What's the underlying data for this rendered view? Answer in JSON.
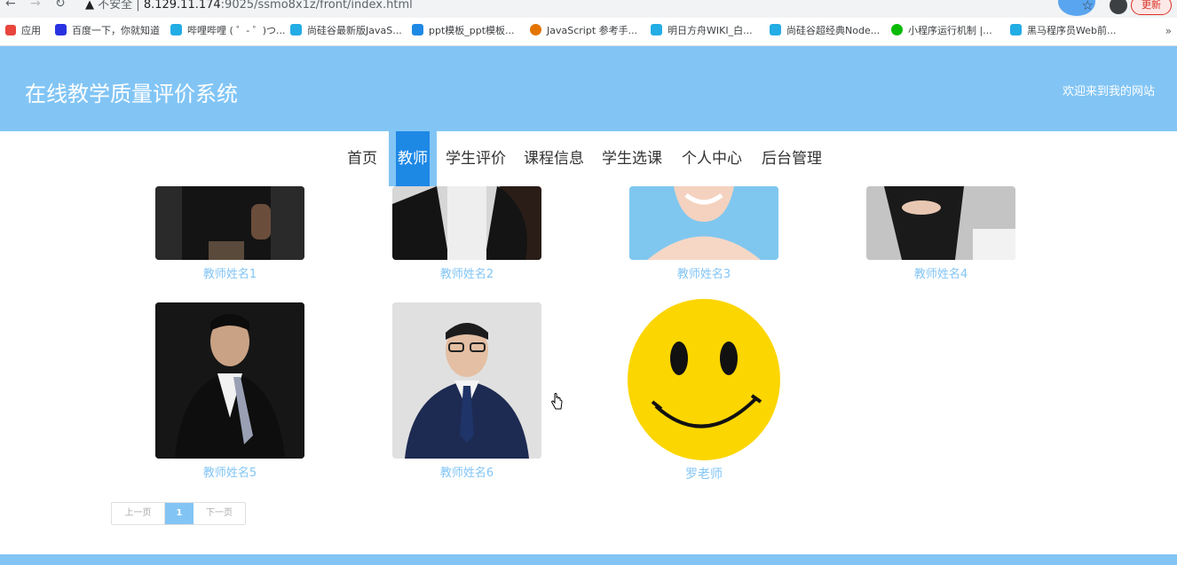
{
  "browser": {
    "back_icon": "arrow-left-icon",
    "warning_label": "不安全",
    "url_host": "8.129.11.174",
    "url_path": ":9025/ssmo8x1z/front/index.html",
    "update_label": "更新",
    "bookmarks": [
      {
        "label": "应用",
        "color": "#e8453c"
      },
      {
        "label": "百度一下，你就知道",
        "color": "#2932e1"
      },
      {
        "label": "哔哩哔哩 ( ゜- ゜)つ...",
        "color": "#23ade5"
      },
      {
        "label": "尚硅谷最新版JavaS...",
        "color": "#23ade5"
      },
      {
        "label": "ppt模板_ppt模板...",
        "color": "#1e88e5"
      },
      {
        "label": "JavaScript 参考手...",
        "color": "#e37400"
      },
      {
        "label": "明日方舟WIKI_白...",
        "color": "#23ade5"
      },
      {
        "label": "尚硅谷超经典Node...",
        "color": "#23ade5"
      },
      {
        "label": "小程序运行机制 |...",
        "color": "#09bb07"
      },
      {
        "label": "黑马程序员Web前...",
        "color": "#23ade5"
      }
    ],
    "more": "»"
  },
  "header": {
    "title": "在线教学质量评价系统",
    "welcome": "欢迎来到我的网站"
  },
  "nav": [
    {
      "label": "首页"
    },
    {
      "label": "教师",
      "active": true
    },
    {
      "label": "学生评价"
    },
    {
      "label": "课程信息"
    },
    {
      "label": "学生选课"
    },
    {
      "label": "个人中心"
    },
    {
      "label": "后台管理"
    }
  ],
  "teachers": [
    {
      "name": "教师姓名1"
    },
    {
      "name": "教师姓名2"
    },
    {
      "name": "教师姓名3"
    },
    {
      "name": "教师姓名4"
    },
    {
      "name": "教师姓名5"
    },
    {
      "name": "教师姓名6"
    },
    {
      "name": "罗老师"
    }
  ],
  "pager": {
    "prev": "上一页",
    "current": "1",
    "next": "下一页"
  },
  "colors": {
    "brand": "#82c5f5",
    "active_nav": "#1e88e5"
  }
}
